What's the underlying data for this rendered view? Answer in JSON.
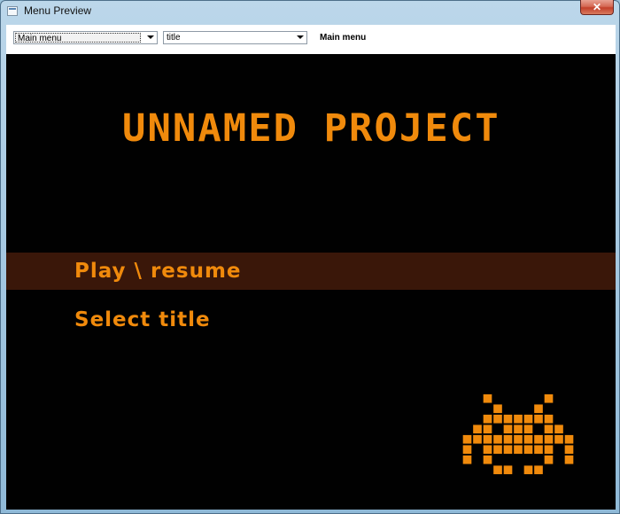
{
  "window": {
    "title": "Menu Preview",
    "close_glyph": "✕"
  },
  "toolbar": {
    "menu_select_value": "Main menu",
    "item_select_value": "title",
    "caption": "Main menu"
  },
  "preview": {
    "game_title": "UNNAMED PROJECT",
    "menu_items": [
      {
        "label": "Play \\ resume",
        "selected": true
      },
      {
        "label": "Select title",
        "selected": false
      }
    ],
    "mascot_icon": "space-invader-icon",
    "colors": {
      "background": "#010101",
      "accent": "#f08a0c",
      "selection": "#3a1709"
    }
  },
  "icons": {
    "app": "app-window-icon",
    "dropdown": "chevron-down-icon"
  }
}
